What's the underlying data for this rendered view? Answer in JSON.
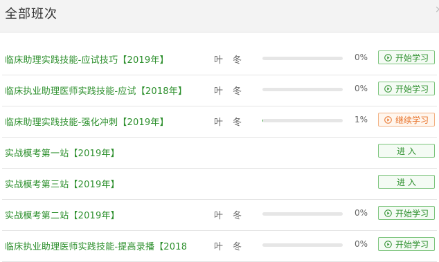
{
  "header": {
    "title": "全部班次",
    "close_glyph": "×"
  },
  "icons": {
    "play": "play-circle-icon",
    "close": "close-icon"
  },
  "colors": {
    "green": "#2c8f2c",
    "orange": "#e8732a",
    "progress": "#3aa33a"
  },
  "rows": [
    {
      "title": "临床助理实践技能-应试技巧【2019年】",
      "teacher": "叶冬",
      "progress_pct": 0,
      "percent": "0%",
      "button": "开始学习",
      "button_type": "start"
    },
    {
      "title": "临床执业助理医师实践技能-应试【2018年】",
      "teacher": "叶冬",
      "progress_pct": 0,
      "percent": "0%",
      "button": "开始学习",
      "button_type": "start"
    },
    {
      "title": "临床助理实践技能-强化冲刺【2019年】",
      "teacher": "叶冬",
      "progress_pct": 1,
      "percent": "1%",
      "button": "继续学习",
      "button_type": "continue"
    },
    {
      "title": "实战模考第一站【2019年】",
      "teacher": "",
      "progress_pct": null,
      "percent": "",
      "button": "进 入",
      "button_type": "enter"
    },
    {
      "title": "实战模考第三站【2019年】",
      "teacher": "",
      "progress_pct": null,
      "percent": "",
      "button": "进 入",
      "button_type": "enter"
    },
    {
      "title": "实战模考第二站【2019年】",
      "teacher": "叶冬",
      "progress_pct": 0,
      "percent": "0%",
      "button": "开始学习",
      "button_type": "start"
    },
    {
      "title": "临床执业助理医师实践技能-提高录播【2018",
      "teacher": "叶冬",
      "progress_pct": 0,
      "percent": "0%",
      "button": "开始学习",
      "button_type": "start"
    }
  ]
}
